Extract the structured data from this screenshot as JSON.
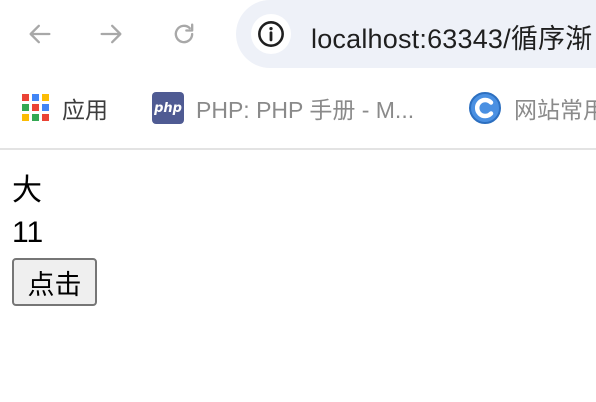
{
  "browser": {
    "url": "localhost:63343/循序渐",
    "icons": {
      "back": "back-arrow-icon",
      "forward": "forward-arrow-icon",
      "reload": "reload-icon",
      "site_info": "info-icon"
    }
  },
  "bookmarks": [
    {
      "label": "应用",
      "icon": "apps-grid-icon"
    },
    {
      "label": "PHP: PHP 手册 - M...",
      "icon": "php-icon",
      "badge_text": "php"
    },
    {
      "label": "网站常用",
      "icon": "c-logo-icon"
    }
  ],
  "page": {
    "text1": "大",
    "text2": "11",
    "button_label": "点击"
  },
  "colors": {
    "omnibox_bg": "#eef1f8",
    "php_badge": "#4f5b93",
    "c_logo": "#4a90e2",
    "nav_icon": "#9aa0a6"
  }
}
